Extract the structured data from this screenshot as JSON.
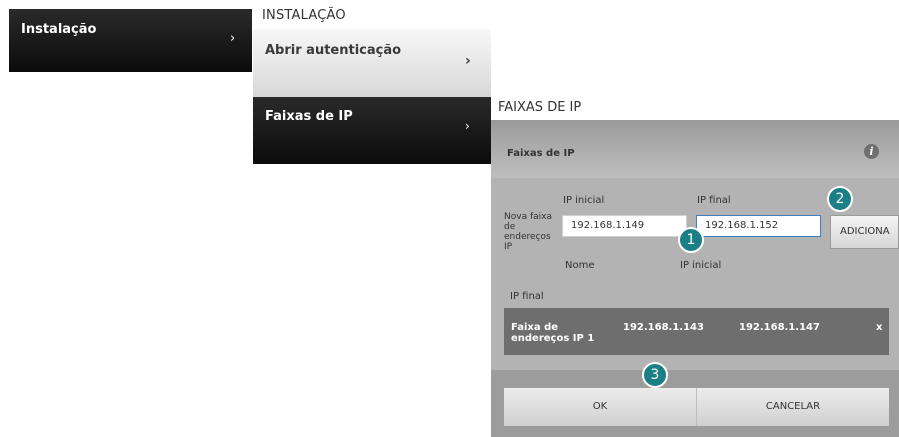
{
  "menu": {
    "instalacao_label": "Instalação",
    "chevron": "›"
  },
  "instalacao_panel": {
    "title": "INSTALAÇÃO",
    "items": [
      {
        "label": "Abrir autenticação",
        "chevron": "›"
      },
      {
        "label": "Faixas de IP",
        "chevron": "›"
      }
    ]
  },
  "faixas_panel": {
    "title": "FAIXAS DE IP",
    "header_label": "Faixas de IP",
    "info_icon": "i",
    "form": {
      "ip_inicial_label": "IP inicial",
      "ip_final_label": "IP final",
      "nova_faixa_label": "Nova faixa de endereços IP",
      "ip_inicial_value": "192.168.1.149",
      "ip_final_value": "192.168.1.152",
      "add_button": "ADICIONA"
    },
    "table_headers": {
      "nome": "Nome",
      "ip_inicial": "IP inicial",
      "ip_final": "IP final"
    },
    "ranges": [
      {
        "name": "Faixa de endereços IP 1",
        "ip_inicial": "192.168.1.143",
        "ip_final": "192.168.1.147",
        "remove": "x"
      }
    ],
    "buttons": {
      "ok": "OK",
      "cancel": "CANCELAR"
    }
  },
  "markers": [
    "1",
    "2",
    "3"
  ]
}
